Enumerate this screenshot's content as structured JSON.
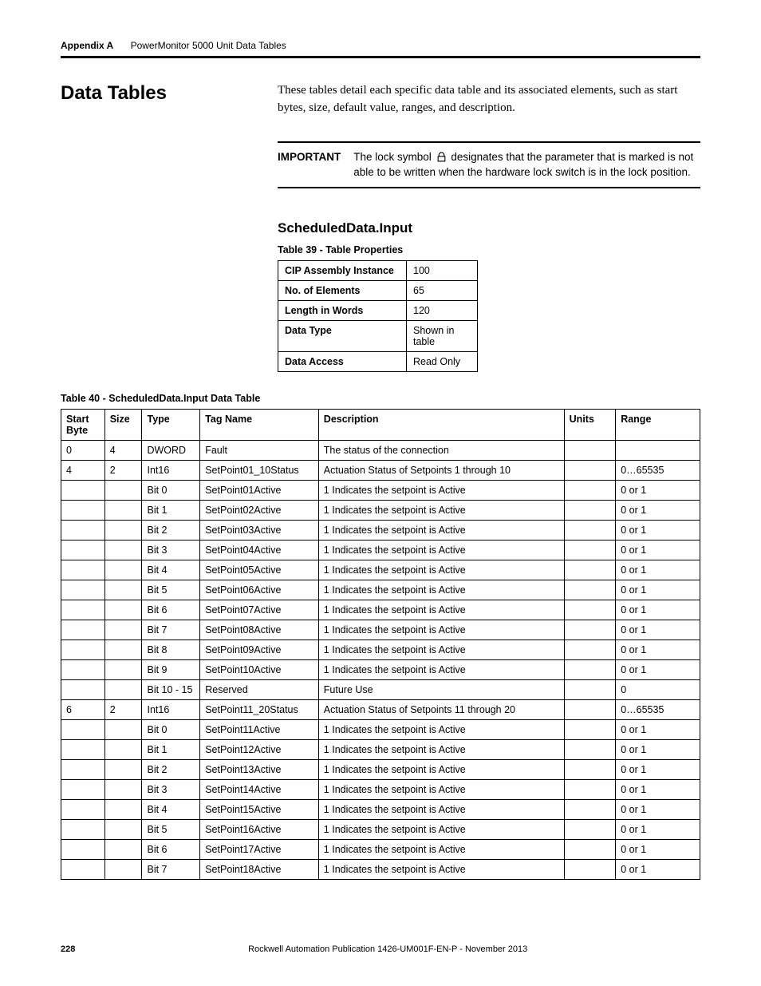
{
  "header": {
    "appendix": "Appendix A",
    "title": "PowerMonitor 5000 Unit Data Tables"
  },
  "side_heading": "Data Tables",
  "intro": "These tables detail each specific data table and its associated elements, such as start bytes, size, default value, ranges, and description.",
  "important": {
    "label": "IMPORTANT",
    "pre": "The lock symbol ",
    "post": " designates that the parameter that is marked is not able to be written when the hardware lock switch is in the lock position."
  },
  "subheading": "ScheduledData.Input",
  "table39_caption": "Table 39 - Table Properties",
  "props": [
    {
      "k": "CIP Assembly Instance",
      "v": "100"
    },
    {
      "k": "No. of Elements",
      "v": "65"
    },
    {
      "k": "Length in Words",
      "v": "120"
    },
    {
      "k": "Data Type",
      "v": "Shown in table"
    },
    {
      "k": "Data Access",
      "v": "Read Only"
    }
  ],
  "table40_caption": "Table 40 - ScheduledData.Input Data Table",
  "columns": {
    "start": "Start Byte",
    "size": "Size",
    "type": "Type",
    "tag": "Tag Name",
    "desc": "Description",
    "units": "Units",
    "range": "Range"
  },
  "rows": [
    {
      "start": "0",
      "size": "4",
      "type": "DWORD",
      "tag": "Fault",
      "desc": "The status of the connection",
      "units": "",
      "range": ""
    },
    {
      "start": "4",
      "size": "2",
      "type": "Int16",
      "tag": "SetPoint01_10Status",
      "desc": "Actuation Status of Setpoints 1 through 10",
      "units": "",
      "range": "0…65535"
    },
    {
      "start": "",
      "size": "",
      "type": "Bit 0",
      "tag": "SetPoint01Active",
      "desc": "1 Indicates the setpoint is Active",
      "units": "",
      "range": "0 or 1"
    },
    {
      "start": "",
      "size": "",
      "type": "Bit 1",
      "tag": "SetPoint02Active",
      "desc": "1 Indicates the setpoint is Active",
      "units": "",
      "range": "0 or 1"
    },
    {
      "start": "",
      "size": "",
      "type": "Bit 2",
      "tag": "SetPoint03Active",
      "desc": "1 Indicates the setpoint is Active",
      "units": "",
      "range": "0 or 1"
    },
    {
      "start": "",
      "size": "",
      "type": "Bit 3",
      "tag": "SetPoint04Active",
      "desc": "1 Indicates the setpoint is Active",
      "units": "",
      "range": "0 or 1"
    },
    {
      "start": "",
      "size": "",
      "type": "Bit 4",
      "tag": "SetPoint05Active",
      "desc": "1 Indicates the setpoint is Active",
      "units": "",
      "range": "0 or 1"
    },
    {
      "start": "",
      "size": "",
      "type": "Bit 5",
      "tag": "SetPoint06Active",
      "desc": "1 Indicates the setpoint is Active",
      "units": "",
      "range": "0 or 1"
    },
    {
      "start": "",
      "size": "",
      "type": "Bit 6",
      "tag": "SetPoint07Active",
      "desc": "1 Indicates the setpoint is Active",
      "units": "",
      "range": "0 or 1"
    },
    {
      "start": "",
      "size": "",
      "type": "Bit 7",
      "tag": "SetPoint08Active",
      "desc": "1 Indicates the setpoint is Active",
      "units": "",
      "range": "0 or 1"
    },
    {
      "start": "",
      "size": "",
      "type": "Bit 8",
      "tag": "SetPoint09Active",
      "desc": "1 Indicates the setpoint is Active",
      "units": "",
      "range": "0 or 1"
    },
    {
      "start": "",
      "size": "",
      "type": "Bit 9",
      "tag": "SetPoint10Active",
      "desc": "1 Indicates the setpoint is Active",
      "units": "",
      "range": "0 or 1"
    },
    {
      "start": "",
      "size": "",
      "type": "Bit 10 - 15",
      "tag": "Reserved",
      "desc": "Future Use",
      "units": "",
      "range": "0"
    },
    {
      "start": "6",
      "size": "2",
      "type": "Int16",
      "tag": "SetPoint11_20Status",
      "desc": "Actuation Status of Setpoints 11 through 20",
      "units": "",
      "range": "0…65535"
    },
    {
      "start": "",
      "size": "",
      "type": "Bit 0",
      "tag": "SetPoint11Active",
      "desc": "1 Indicates the setpoint is Active",
      "units": "",
      "range": "0 or 1"
    },
    {
      "start": "",
      "size": "",
      "type": "Bit 1",
      "tag": "SetPoint12Active",
      "desc": "1 Indicates the setpoint is Active",
      "units": "",
      "range": "0 or 1"
    },
    {
      "start": "",
      "size": "",
      "type": "Bit 2",
      "tag": "SetPoint13Active",
      "desc": "1 Indicates the setpoint is Active",
      "units": "",
      "range": "0 or 1"
    },
    {
      "start": "",
      "size": "",
      "type": "Bit 3",
      "tag": "SetPoint14Active",
      "desc": "1 Indicates the setpoint is Active",
      "units": "",
      "range": "0 or 1"
    },
    {
      "start": "",
      "size": "",
      "type": "Bit 4",
      "tag": "SetPoint15Active",
      "desc": "1 Indicates the setpoint is Active",
      "units": "",
      "range": "0 or 1"
    },
    {
      "start": "",
      "size": "",
      "type": "Bit 5",
      "tag": "SetPoint16Active",
      "desc": "1 Indicates the setpoint is Active",
      "units": "",
      "range": "0 or 1"
    },
    {
      "start": "",
      "size": "",
      "type": "Bit 6",
      "tag": "SetPoint17Active",
      "desc": "1 Indicates the setpoint is Active",
      "units": "",
      "range": "0 or 1"
    },
    {
      "start": "",
      "size": "",
      "type": "Bit 7",
      "tag": "SetPoint18Active",
      "desc": "1 Indicates the setpoint is Active",
      "units": "",
      "range": "0 or 1"
    }
  ],
  "footer": {
    "page": "228",
    "pub": "Rockwell Automation Publication 1426-UM001F-EN-P - November 2013"
  }
}
